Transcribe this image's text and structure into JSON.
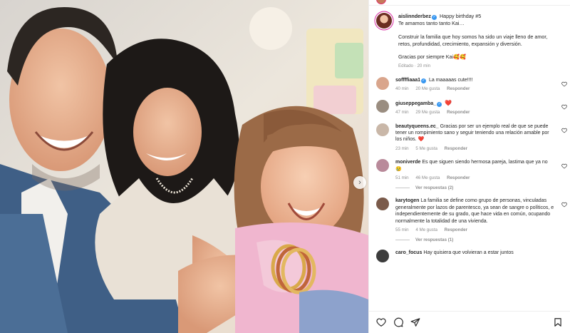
{
  "post": {
    "username": "aislinnderbez",
    "caption_inline": "Happy birthday #5",
    "caption_lines": [
      "Te amamos tanto tanto Kai…",
      "",
      "Construir la familia que hoy somos ha sido un viaje lleno de amor, retos, profundidad, crecimiento, expansión y diversión.",
      "",
      "Gracias por siempre Kai🥰🥰"
    ],
    "edited_label": "Editado · 20 min"
  },
  "comments": [
    {
      "username": "soffffiaaa1",
      "verified": true,
      "text": "La maaaaas cute!!!!",
      "time": "40 min",
      "likes": "20 Me gusta",
      "reply": "Responder",
      "avatar_color": "#d9a58c"
    },
    {
      "username": "giuseppegamba_",
      "verified": true,
      "text": "❤️",
      "time": "47 min",
      "likes": "29 Me gusta",
      "reply": "Responder",
      "avatar_color": "#9a8d80"
    },
    {
      "username": "beautyqueens.ec_",
      "verified": false,
      "text": "Gracias por ser un ejemplo real de que se puede tener un rompimiento sano y seguir teniendo una relación amable por los niños. ❤️",
      "time": "23 min",
      "likes": "5 Me gusta",
      "reply": "Responder",
      "avatar_color": "#c9b7a8"
    },
    {
      "username": "moniverde",
      "verified": false,
      "text": "Es que siguen siendo hermosa pareja, lastima que ya no 😢",
      "time": "51 min",
      "likes": "46 Me gusta",
      "reply": "Responder",
      "avatar_color": "#b98a9a",
      "replies": "Ver respuestas (2)"
    },
    {
      "username": "karytogen",
      "verified": false,
      "text": "La familia se define como grupo de personas, vinculadas generalmente por lazos de parentesco, ya sean de sangre o políticos, e independientemente de su grado, que hace vida en común, ocupando normalmente la totalidad de una vivienda.",
      "time": "55 min",
      "likes": "4 Me gusta",
      "reply": "Responder",
      "avatar_color": "#7a5a4a",
      "replies": "Ver respuestas (1)"
    },
    {
      "username": "caro_focus",
      "verified": false,
      "text": "Hay quisiera que volvieran a estar juntos",
      "time": "",
      "likes": "",
      "reply": "",
      "avatar_color": "#3c3c3c"
    }
  ],
  "icons": {
    "next": "chevron-right-icon",
    "like": "heart-icon",
    "comment": "comment-icon",
    "share": "paper-plane-icon",
    "save": "bookmark-icon"
  },
  "colors": {
    "verified": "#3897f0",
    "heart": "#ed4956",
    "muted": "#8e8e8e",
    "story_ring": "#d6249f"
  }
}
